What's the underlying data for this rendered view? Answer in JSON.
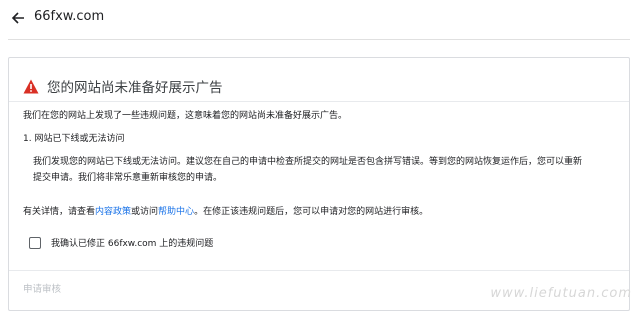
{
  "header": {
    "site_name": "66fxw.com"
  },
  "card": {
    "title": "您的网站尚未准备好展示广告",
    "lead": "我们在您的网站上发现了一些违规问题，这意味着您的网站尚未准备好展示广告。",
    "issue_heading": "1. 网站已下线或无法访问",
    "issue_line1": "我们发现您的网站已下线或无法访问。建议您在自己的申请中检查所提交的网址是否包含拼写错误。等到您的网站恢复运作后，您可以重新",
    "issue_line2": "提交申请。我们将非常乐意重新审核您的申请。",
    "note_pre": "有关详情，请查看",
    "link_policy": "内容政策",
    "note_mid": "或访问",
    "link_help": "帮助中心",
    "note_post": "。在修正该违规问题后，您可以申请对您的网站进行审核。",
    "confirm_label": "我确认已修正 66fxw.com 上的违规问题",
    "submit_label": "申请审核"
  },
  "watermark": "www.liefutuan.com",
  "colors": {
    "warning": "#d93025",
    "link": "#1a73e8"
  },
  "icons": {
    "back": "arrow-left-icon",
    "warning": "warning-icon"
  }
}
